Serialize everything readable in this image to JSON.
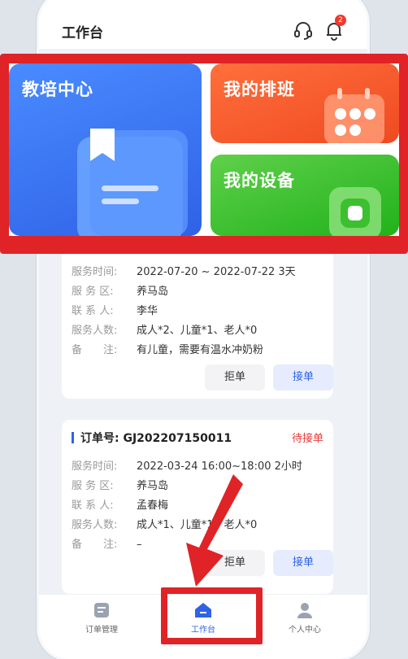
{
  "header": {
    "title": "工作台",
    "notification_count": "2"
  },
  "banner": {
    "tiles": [
      {
        "label": "教培中心",
        "color": "#3a7bf6"
      },
      {
        "label": "我的排班",
        "color": "#f25a2c"
      },
      {
        "label": "我的设备",
        "color": "#34c32c"
      }
    ]
  },
  "order1": {
    "fields": [
      {
        "label": "服务时间:",
        "value": "2022-07-20 ~ 2022-07-22 3天"
      },
      {
        "label": "服 务 区:",
        "value": "养马岛"
      },
      {
        "label": "联 系 人:",
        "value": "李华"
      },
      {
        "label": "服务人数:",
        "value": "成人*2、儿童*1、老人*0"
      },
      {
        "label": "备　　注:",
        "value": "有儿童，需要有温水冲奶粉"
      }
    ],
    "reject_label": "拒单",
    "accept_label": "接单"
  },
  "order2": {
    "number_label": "订单号:",
    "number": "GJ202207150011",
    "status": "待接单",
    "fields": [
      {
        "label": "服务时间:",
        "value": "2022-03-24 16:00~18:00 2小时"
      },
      {
        "label": "服 务 区:",
        "value": "养马岛"
      },
      {
        "label": "联 系 人:",
        "value": "孟春梅"
      },
      {
        "label": "服务人数:",
        "value": "成人*1、儿童*1、老人*0"
      },
      {
        "label": "备　　注:",
        "value": "–"
      }
    ],
    "reject_label": "拒单",
    "accept_label": "接单"
  },
  "tabbar": {
    "tabs": [
      {
        "label": "订单管理"
      },
      {
        "label": "工作台"
      },
      {
        "label": "个人中心"
      }
    ],
    "active_color": "#2f62e6"
  },
  "annotation_color": "#e02326"
}
